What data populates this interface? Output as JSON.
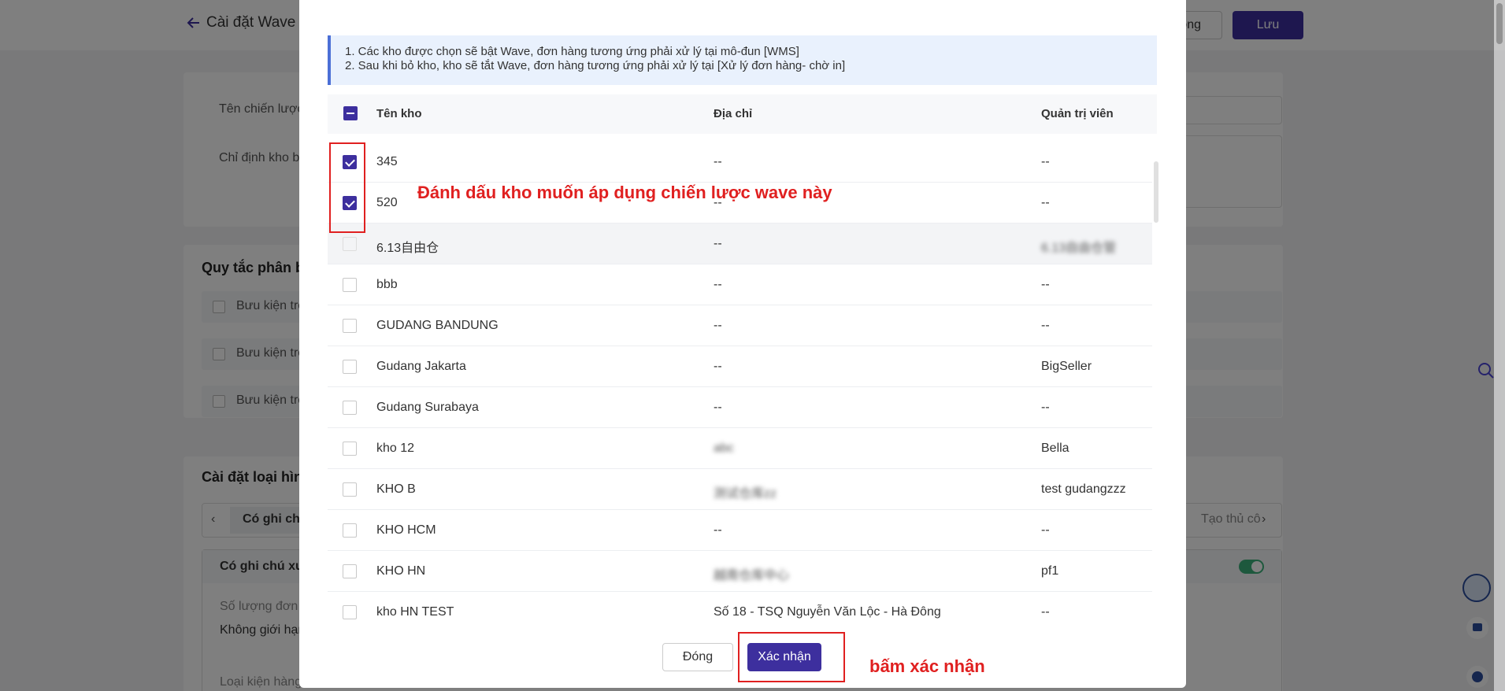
{
  "page": {
    "back_label": "Cài đặt Wave >",
    "cancel_label": "ông",
    "save_label": "Lưu",
    "card1": {
      "strategy_label": "Tên chiến lược",
      "warehouse_label": "Chỉ định kho bả"
    },
    "card2": {
      "title": "Quy tắc phân bi",
      "rules": [
        "Bưu kiện trơ",
        "Bưu kiện trơ",
        "Bưu kiện trơ"
      ]
    },
    "card3": {
      "title": "Cài đặt loại hình",
      "tab_selected": "Có ghi chú",
      "tab_right": "Tạo thủ cô",
      "subcard_title": "Có ghi chú xuấ",
      "quantity_label": "Số lượng đơn h",
      "quantity_value": "Không giới hạn",
      "package_label": "Loại kiện hàng"
    }
  },
  "modal": {
    "notice": [
      "1. Các kho được chọn sẽ bật Wave, đơn hàng tương ứng phải xử lý tại mô-đun [WMS]",
      "2. Sau khi bỏ kho, kho sẽ tắt Wave, đơn hàng tương ứng phải xử lý tại [Xử lý đơn hàng- chờ in]"
    ],
    "columns": {
      "name": "Tên kho",
      "address": "Địa chỉ",
      "admin": "Quản trị viên"
    },
    "rows": [
      {
        "name": "345",
        "address": "--",
        "admin": "--",
        "checked": true
      },
      {
        "name": "520",
        "address": "--",
        "admin": "--",
        "checked": true
      },
      {
        "name": "6.13自由仓",
        "address": "--",
        "admin": "6.13自由仓管",
        "checked": false
      },
      {
        "name": "bbb",
        "address": "--",
        "admin": "--",
        "checked": false
      },
      {
        "name": "GUDANG BANDUNG",
        "address": "--",
        "admin": "--",
        "checked": false
      },
      {
        "name": "Gudang Jakarta",
        "address": "--",
        "admin": "BigSeller",
        "checked": false
      },
      {
        "name": "Gudang Surabaya",
        "address": "--",
        "admin": "--",
        "checked": false
      },
      {
        "name": "kho 12",
        "address": "abc",
        "admin": "Bella",
        "checked": false
      },
      {
        "name": "KHO B",
        "address": "测试仓库zz",
        "admin": "test gudangzzz",
        "checked": false
      },
      {
        "name": "KHO HCM",
        "address": "--",
        "admin": "--",
        "checked": false
      },
      {
        "name": "KHO HN",
        "address": "越南仓库中心",
        "admin": "pf1",
        "checked": false
      },
      {
        "name": "kho HN TEST",
        "address": "Số 18 - TSQ Nguyễn Văn Lộc - Hà Đông",
        "admin": "--",
        "checked": false
      }
    ],
    "close_label": "Đóng",
    "confirm_label": "Xác nhận"
  },
  "annotations": {
    "mark_text": "Đánh dấu kho muốn áp dụng chiến lược wave này",
    "confirm_text": "bấm xác nhận",
    "color": "#e02020"
  },
  "colors": {
    "primary": "#3d2f9e",
    "notice_bg": "#e9f1fd",
    "toggle_on": "#3bb07a"
  }
}
